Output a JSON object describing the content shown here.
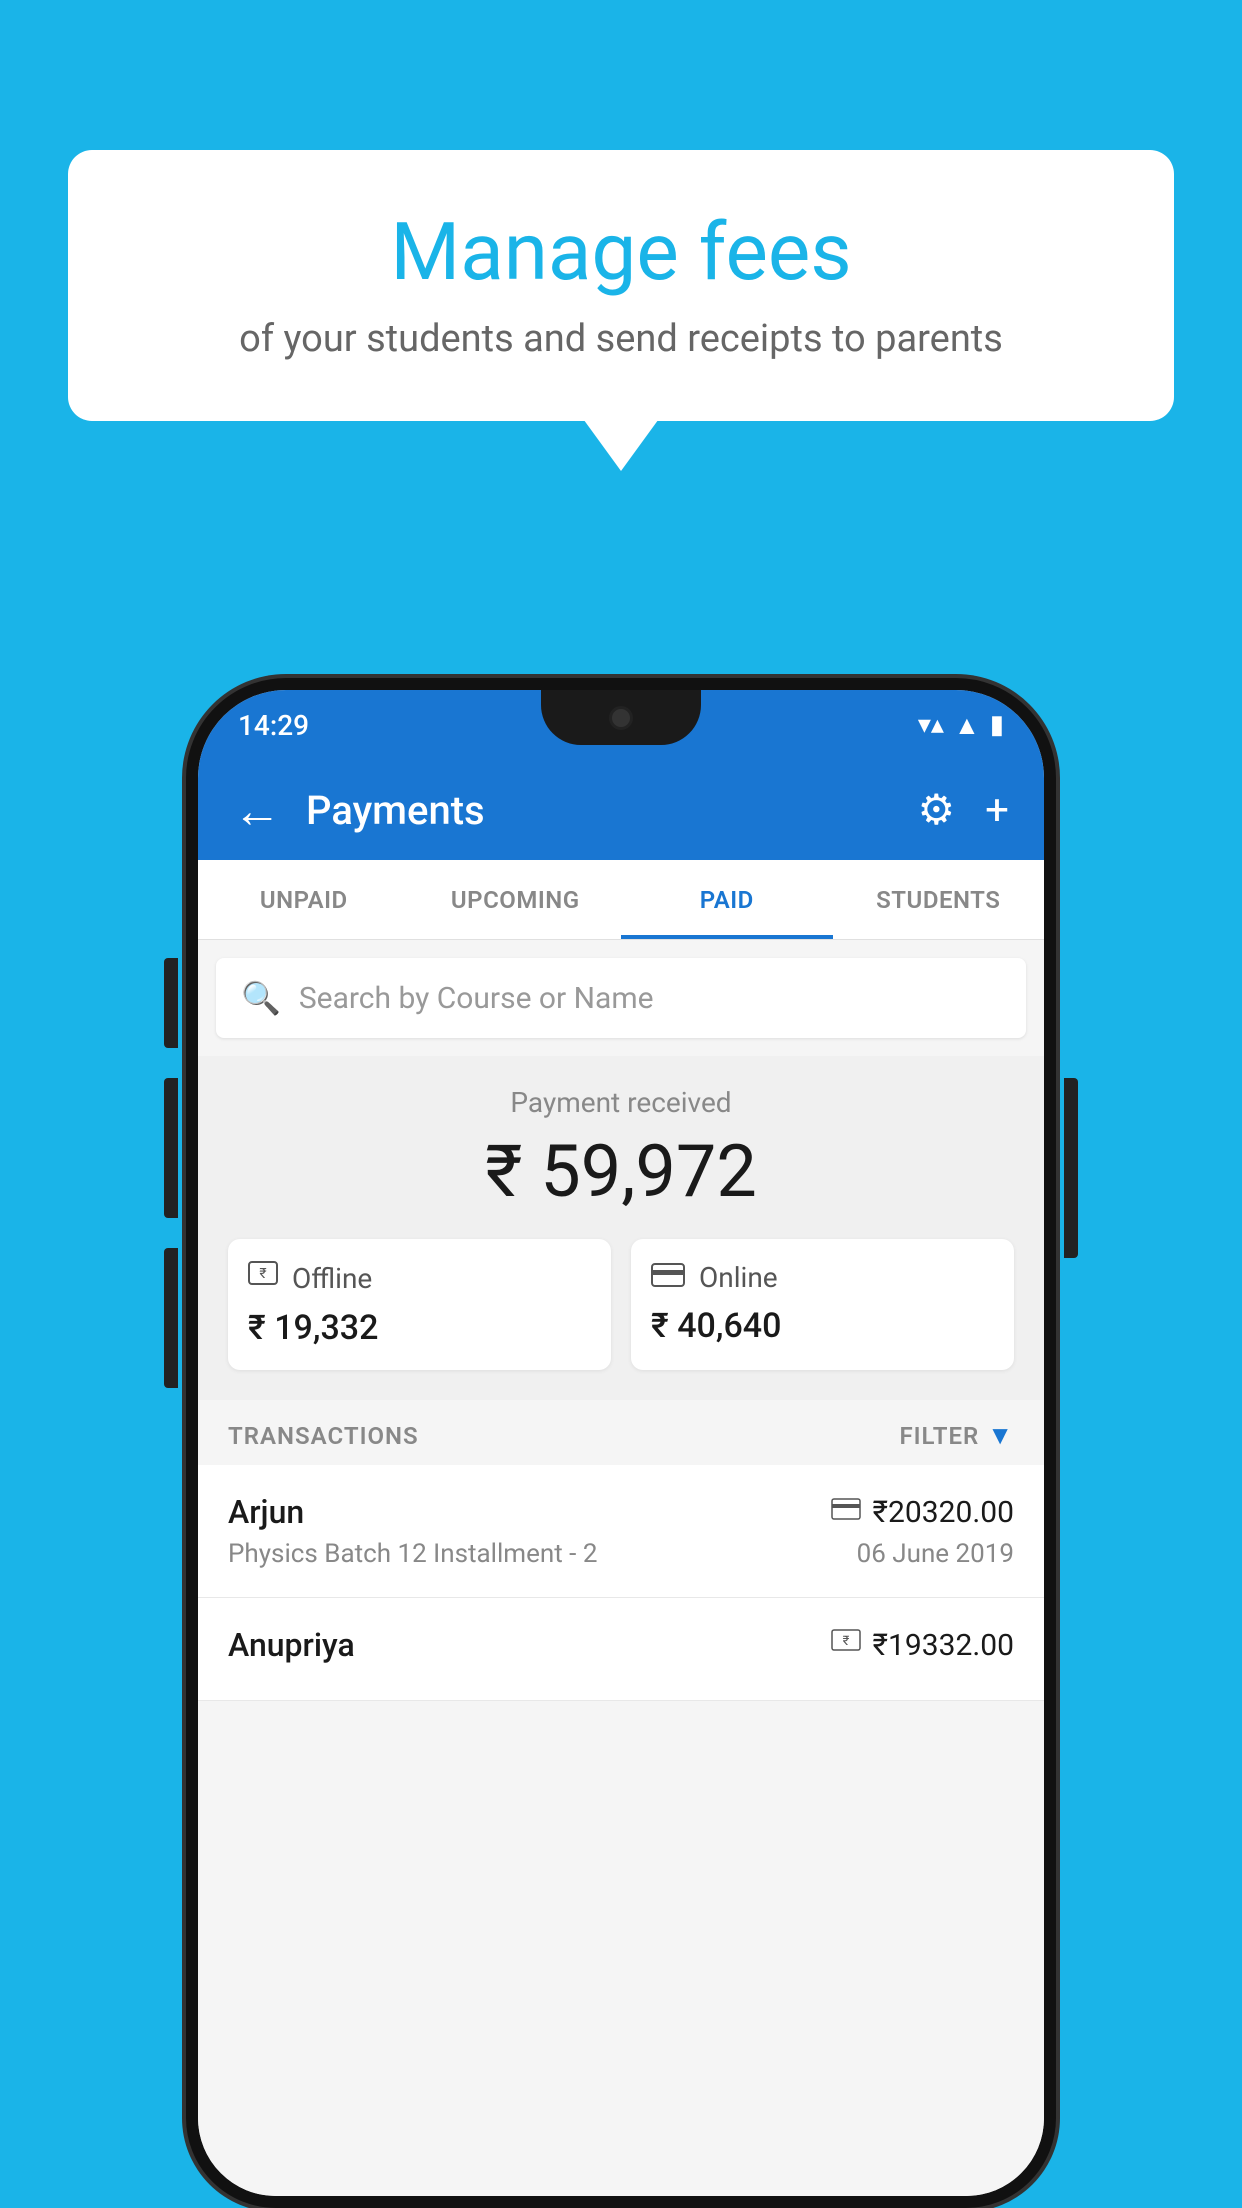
{
  "background_color": "#1ab4e8",
  "speech_bubble": {
    "title": "Manage fees",
    "subtitle": "of your students and send receipts to parents"
  },
  "status_bar": {
    "time": "14:29",
    "wifi": "▼",
    "signal": "▲",
    "battery": "▮"
  },
  "app_bar": {
    "back_label": "←",
    "title": "Payments",
    "gear_label": "⚙",
    "plus_label": "+"
  },
  "tabs": [
    {
      "label": "UNPAID",
      "active": false
    },
    {
      "label": "UPCOMING",
      "active": false
    },
    {
      "label": "PAID",
      "active": true
    },
    {
      "label": "STUDENTS",
      "active": false
    }
  ],
  "search": {
    "placeholder": "Search by Course or Name"
  },
  "payment_summary": {
    "received_label": "Payment received",
    "total_amount": "₹ 59,972",
    "offline": {
      "label": "Offline",
      "amount": "₹ 19,332"
    },
    "online": {
      "label": "Online",
      "amount": "₹ 40,640"
    }
  },
  "transactions": {
    "header_label": "TRANSACTIONS",
    "filter_label": "FILTER",
    "items": [
      {
        "name": "Arjun",
        "amount": "₹20320.00",
        "payment_type": "card",
        "description": "Physics Batch 12 Installment - 2",
        "date": "06 June 2019"
      },
      {
        "name": "Anupriya",
        "amount": "₹19332.00",
        "payment_type": "offline",
        "description": "",
        "date": ""
      }
    ]
  }
}
